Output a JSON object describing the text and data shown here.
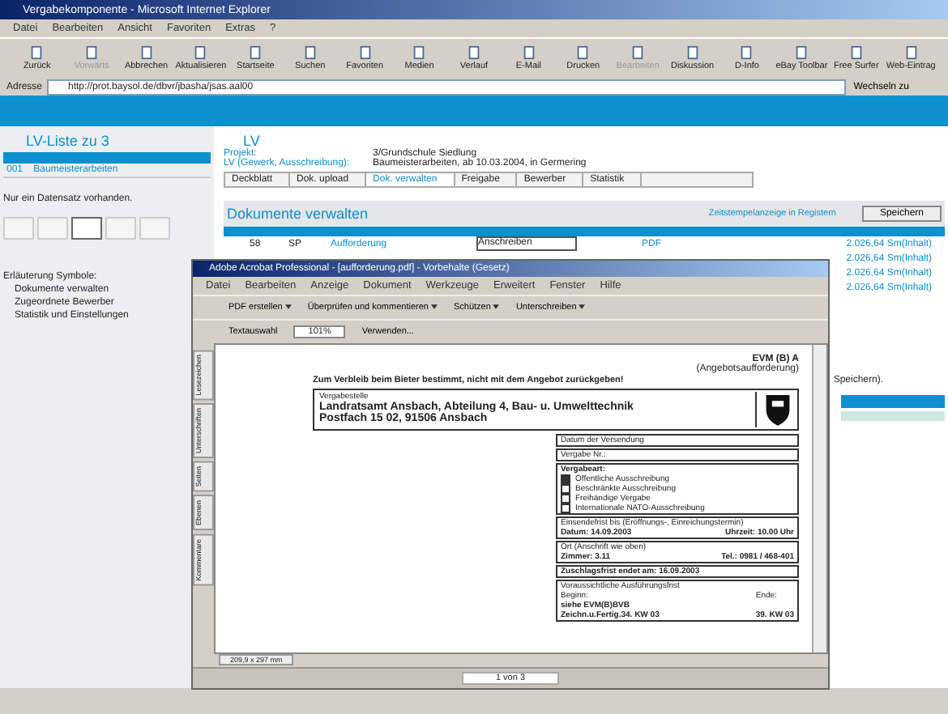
{
  "browser": {
    "title": "Vergabekomponente - Microsoft Internet Explorer",
    "menu": [
      "Datei",
      "Bearbeiten",
      "Ansicht",
      "Favoriten",
      "Extras",
      "?"
    ],
    "toolbar": [
      {
        "label": "Zurück",
        "disabled": false
      },
      {
        "label": "Vorwärts",
        "disabled": true
      },
      {
        "label": "Abbrechen",
        "disabled": false
      },
      {
        "label": "Aktualisieren",
        "disabled": false
      },
      {
        "label": "Startseite",
        "disabled": false
      },
      {
        "label": "Suchen",
        "disabled": false
      },
      {
        "label": "Favoriten",
        "disabled": false
      },
      {
        "label": "Medien",
        "disabled": false
      },
      {
        "label": "Verlauf",
        "disabled": false
      },
      {
        "label": "E-Mail",
        "disabled": false
      },
      {
        "label": "Drucken",
        "disabled": false
      },
      {
        "label": "Bearbeiten",
        "disabled": true
      },
      {
        "label": "Diskussion",
        "disabled": false
      },
      {
        "label": "D-Info",
        "disabled": false
      },
      {
        "label": "eBay Toolbar",
        "disabled": false
      },
      {
        "label": "Free Surfer",
        "disabled": false
      },
      {
        "label": "Web-Eintrag",
        "disabled": false
      }
    ],
    "address_label": "Adresse",
    "address": "http://prot.baysol.de/dbvr/jbasha/jsas.aal00",
    "go": "Wechseln zu"
  },
  "sidebar": {
    "title": "LV-Liste zu 3",
    "rows": [
      {
        "number": "001",
        "name": "Baumeisterarbeiten",
        "selected": false
      }
    ],
    "note": "Nur ein Datensatz vorhanden.",
    "pager": [
      {
        "selected": false
      },
      {
        "selected": false
      },
      {
        "selected": true
      },
      {
        "selected": false
      },
      {
        "selected": false
      }
    ],
    "legend_title": "Erläuterung Symbole:",
    "legend": [
      "Dokumente verwalten",
      "Zugeordnete Bewerber",
      "Statistik und Einstellungen"
    ]
  },
  "lv": {
    "title": "LV",
    "fields": [
      {
        "label": "Projekt:",
        "value": "3/Grundschule Siedlung"
      },
      {
        "label": "LV (Gewerk, Ausschreibung):",
        "value": "Baumeisterarbeiten, ab 10.03.2004, in Germering"
      }
    ],
    "tabs": [
      {
        "label": "Deckblatt",
        "selected": false
      },
      {
        "label": "Dok. upload",
        "selected": false
      },
      {
        "label": "Dok. verwalten",
        "selected": true
      },
      {
        "label": "Freigabe",
        "selected": false
      },
      {
        "label": "Bewerber",
        "selected": false
      },
      {
        "label": "Statistik",
        "selected": false
      }
    ],
    "section_title": "Dokumente verwalten",
    "section_link": "Zeitstempelanzeige in Registern",
    "save": "Speichern",
    "first_row": {
      "number": "58",
      "code": "SP",
      "name": "Aufforderung",
      "type": "Anschreiben",
      "format": "PDF",
      "size": "2.026,64 Sm(Inhalt)"
    },
    "more_rows": [
      "2.026,64 Sm(Inhalt)",
      "2.026,64 Sm(Inhalt)",
      "2.026,64 Sm(Inhalt)"
    ],
    "hint": "Speichern)."
  },
  "acrobat": {
    "title": "Adobe Acrobat Professional - [aufforderung.pdf] - Vorbehalte (Gesetz)",
    "menu": [
      "Datei",
      "Bearbeiten",
      "Anzeige",
      "Dokument",
      "Werkzeuge",
      "Erweitert",
      "Fenster",
      "Hilfe"
    ],
    "tools": [
      "PDF erstellen",
      "Überprüfen und kommentieren",
      "Schützen",
      "Unterschreiben"
    ],
    "select_tool": "Textauswahl",
    "zoom": "101%",
    "verwenden": "Verwenden...",
    "side_tabs": [
      "Lesezeichen",
      "Unterschriften",
      "Seiten",
      "Ebenen",
      "Kommentare"
    ],
    "doc": {
      "code": "EVM (B) A",
      "subtitle": "(Angebotsaufforderung)",
      "notice": "Zum Verbleib beim Bieter bestimmt, nicht mit dem Angebot zurückgeben!",
      "office_label": "Vergabestelle",
      "office": [
        "Landratsamt Ansbach, Abteilung 4, Bau- u. Umwelttechnik",
        "Postfach 15 02, 91506 Ansbach"
      ],
      "sent": "Datum der Versendung",
      "vergabe_nr": "Vergabe Nr.:",
      "art_label": "Vergabeart:",
      "art": [
        {
          "label": "Öffentliche Ausschreibung",
          "checked": true
        },
        {
          "label": "Beschränkte Ausschreibung",
          "checked": false
        },
        {
          "label": "Freihändige Vergabe",
          "checked": false
        },
        {
          "label": "Internationale NATO-Ausschreibung",
          "checked": false
        }
      ],
      "deadline": "Einsendefrist bis (Eröffnungs-, Einreichungstermin)",
      "date": "Datum: 14.09.2003",
      "time": "Uhrzeit: 10.00 Uhr",
      "place": "Ort (Anschrift wie oben)",
      "room": "Zimmer: 3.11",
      "phone": "Tel.: 0981 / 468-401",
      "award": "Zuschlagsfrist endet am: 16.09.2003",
      "period": "Voraussichtliche Ausführungsfrist",
      "start_label": "Beginn:",
      "end_label": "Ende:",
      "start": [
        "siehe EVM(B)BVB",
        "Zeichn.u.Fertig.34. KW 03"
      ],
      "end": "39. KW 03"
    },
    "page_size": "209,9 x 297 mm",
    "page": "1 von 3"
  }
}
